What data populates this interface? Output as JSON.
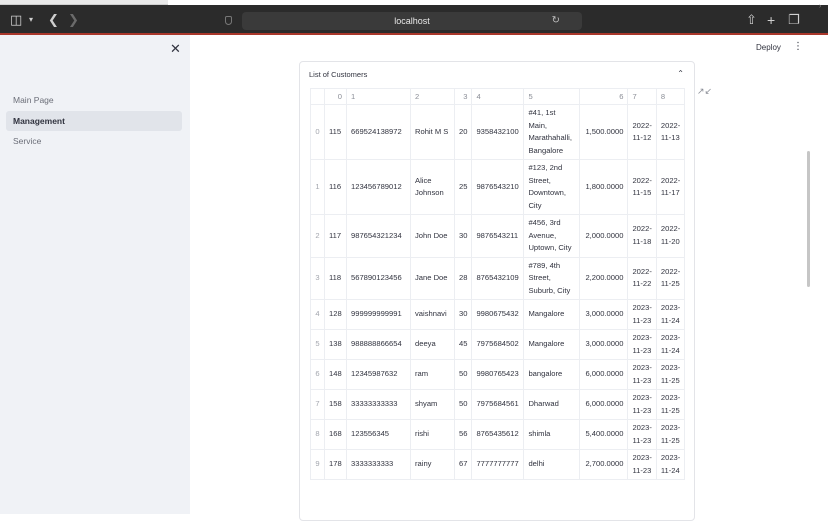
{
  "browser": {
    "url": "localhost"
  },
  "sidebar": {
    "items": [
      {
        "label": "Main Page",
        "active": false
      },
      {
        "label": "Management",
        "active": true
      },
      {
        "label": "Service",
        "active": false
      }
    ]
  },
  "header": {
    "deploy_label": "Deploy"
  },
  "card": {
    "title": "List of Customers"
  },
  "table": {
    "columns": [
      "",
      "0",
      "1",
      "2",
      "3",
      "4",
      "5",
      "6",
      "7",
      "8"
    ],
    "rows": [
      [
        "0",
        "115",
        "669524138972",
        "Rohit M S",
        "20",
        "9358432100",
        "#41, 1st Main, Marathahalli, Bangalore",
        "1,500.0000",
        "2022-11-12",
        "2022-11-13"
      ],
      [
        "1",
        "116",
        "123456789012",
        "Alice Johnson",
        "25",
        "9876543210",
        "#123, 2nd Street, Downtown, City",
        "1,800.0000",
        "2022-11-15",
        "2022-11-17"
      ],
      [
        "2",
        "117",
        "987654321234",
        "John Doe",
        "30",
        "9876543211",
        "#456, 3rd Avenue, Uptown, City",
        "2,000.0000",
        "2022-11-18",
        "2022-11-20"
      ],
      [
        "3",
        "118",
        "567890123456",
        "Jane Doe",
        "28",
        "8765432109",
        "#789, 4th Street, Suburb, City",
        "2,200.0000",
        "2022-11-22",
        "2022-11-25"
      ],
      [
        "4",
        "128",
        "999999999991",
        "vaishnavi",
        "30",
        "9980675432",
        "Mangalore",
        "3,000.0000",
        "2023-11-23",
        "2023-11-24"
      ],
      [
        "5",
        "138",
        "988888866654",
        "deeya",
        "45",
        "7975684502",
        "Mangalore",
        "3,000.0000",
        "2023-11-23",
        "2023-11-24"
      ],
      [
        "6",
        "148",
        "12345987632",
        "ram",
        "50",
        "9980765423",
        "bangalore",
        "6,000.0000",
        "2023-11-23",
        "2023-11-25"
      ],
      [
        "7",
        "158",
        "33333333333",
        "shyam",
        "50",
        "7975684561",
        "Dharwad",
        "6,000.0000",
        "2023-11-23",
        "2023-11-25"
      ],
      [
        "8",
        "168",
        "123556345",
        "rishi",
        "56",
        "8765435612",
        "shimla",
        "5,400.0000",
        "2023-11-23",
        "2023-11-25"
      ],
      [
        "9",
        "178",
        "3333333333",
        "rainy",
        "67",
        "7777777777",
        "delhi",
        "2,700.0000",
        "2023-11-23",
        "2023-11-24"
      ]
    ]
  },
  "icons": {
    "sidebar_toggle": "sidebar-toggle-icon",
    "back": "chevron-left-icon",
    "forward": "chevron-right-icon",
    "share": "share-icon",
    "new_tab": "plus-icon",
    "tabs": "tabs-overview-icon",
    "close": "close-icon",
    "menu": "more-vertical-icon",
    "collapse": "chevron-up-icon",
    "fullscreen": "expand-icon"
  }
}
